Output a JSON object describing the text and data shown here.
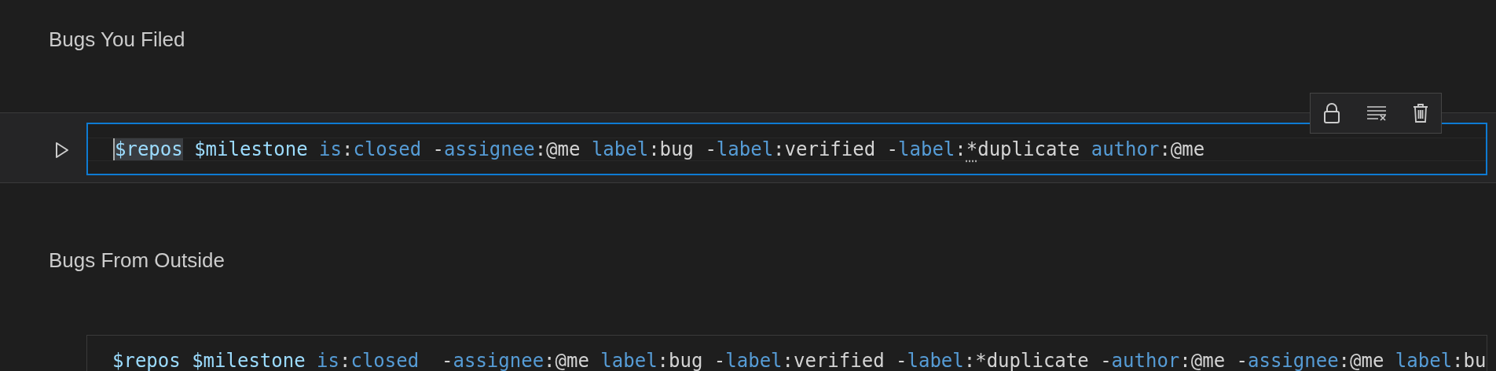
{
  "cells": [
    {
      "kind": "markdown",
      "text": "Bugs You Filed"
    },
    {
      "kind": "code",
      "hovered": true,
      "focused": true,
      "tokens": [
        {
          "text": "$repos",
          "kind": "variable",
          "highlighted": true
        },
        {
          "text": " $milestone ",
          "kind": "variable"
        },
        {
          "text": "is",
          "kind": "keyword"
        },
        {
          "text": ":",
          "kind": "plain"
        },
        {
          "text": "closed",
          "kind": "keyword"
        },
        {
          "text": " -",
          "kind": "plain"
        },
        {
          "text": "assignee",
          "kind": "keyword"
        },
        {
          "text": ":@me ",
          "kind": "plain"
        },
        {
          "text": "label",
          "kind": "keyword"
        },
        {
          "text": ":bug -",
          "kind": "plain"
        },
        {
          "text": "label",
          "kind": "keyword"
        },
        {
          "text": ":verified -",
          "kind": "plain"
        },
        {
          "text": "label",
          "kind": "keyword"
        },
        {
          "text": ":",
          "kind": "plain"
        },
        {
          "text": "*",
          "kind": "plain",
          "hint": true
        },
        {
          "text": "duplicate ",
          "kind": "plain"
        },
        {
          "text": "author",
          "kind": "keyword"
        },
        {
          "text": ":@me",
          "kind": "plain"
        }
      ]
    },
    {
      "kind": "markdown",
      "text": "Bugs From Outside"
    },
    {
      "kind": "code",
      "hovered": false,
      "focused": false,
      "tokens": [
        {
          "text": "$repos $milestone ",
          "kind": "variable"
        },
        {
          "text": "is",
          "kind": "keyword"
        },
        {
          "text": ":",
          "kind": "plain"
        },
        {
          "text": "closed",
          "kind": "keyword"
        },
        {
          "text": "  -",
          "kind": "plain"
        },
        {
          "text": "assignee",
          "kind": "keyword"
        },
        {
          "text": ":@me ",
          "kind": "plain"
        },
        {
          "text": "label",
          "kind": "keyword"
        },
        {
          "text": ":bug -",
          "kind": "plain"
        },
        {
          "text": "label",
          "kind": "keyword"
        },
        {
          "text": ":verified -",
          "kind": "plain"
        },
        {
          "text": "label",
          "kind": "keyword"
        },
        {
          "text": ":*duplicate -",
          "kind": "plain"
        },
        {
          "text": "author",
          "kind": "keyword"
        },
        {
          "text": ":@me -",
          "kind": "plain"
        },
        {
          "text": "assignee",
          "kind": "keyword"
        },
        {
          "text": ":@me ",
          "kind": "plain"
        },
        {
          "text": "label",
          "kind": "keyword"
        },
        {
          "text": ":bu",
          "kind": "plain"
        }
      ]
    }
  ]
}
